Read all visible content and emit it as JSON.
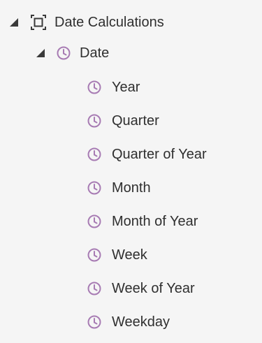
{
  "tree": {
    "root": {
      "label": "Date Calculations",
      "icon": "folder-bracket-icon",
      "expanded": true
    },
    "date_group": {
      "label": "Date",
      "icon": "clock-icon",
      "expanded": true
    },
    "items": [
      {
        "label": "Year",
        "icon": "clock-icon"
      },
      {
        "label": "Quarter",
        "icon": "clock-icon"
      },
      {
        "label": "Quarter of Year",
        "icon": "clock-icon"
      },
      {
        "label": "Month",
        "icon": "clock-icon"
      },
      {
        "label": "Month of Year",
        "icon": "clock-icon"
      },
      {
        "label": "Week",
        "icon": "clock-icon"
      },
      {
        "label": "Week of Year",
        "icon": "clock-icon"
      },
      {
        "label": "Weekday",
        "icon": "clock-icon"
      }
    ]
  },
  "colors": {
    "clock_icon": "#a77bb3",
    "text": "#2f2f2f",
    "panel_bg": "#f5f5f5"
  }
}
